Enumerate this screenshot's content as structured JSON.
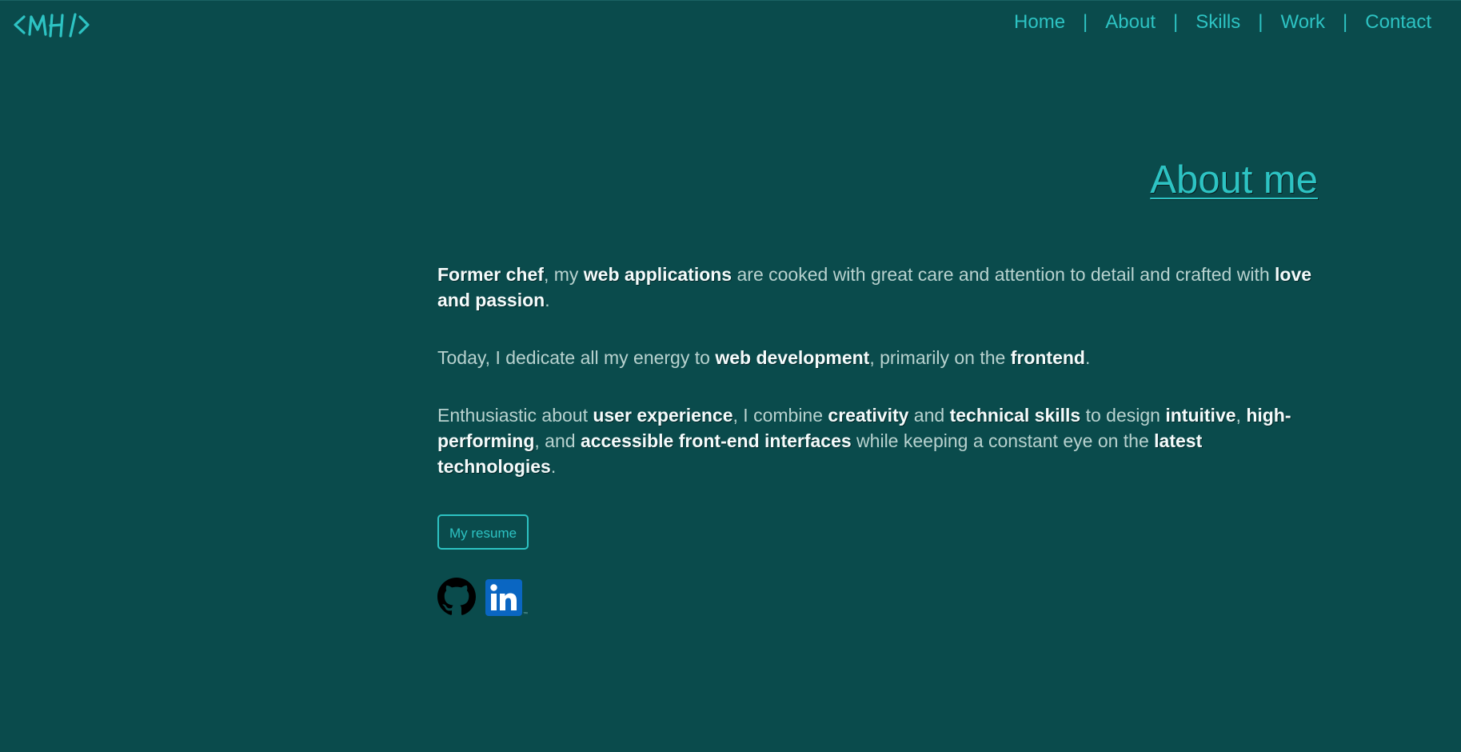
{
  "brand": {
    "logo_alt": "<MH/>",
    "logo_icon": "code-brackets-mh-logo"
  },
  "nav": {
    "items": [
      {
        "label": "Home"
      },
      {
        "label": "About"
      },
      {
        "label": "Skills"
      },
      {
        "label": "Work"
      },
      {
        "label": "Contact"
      }
    ],
    "separator": "|"
  },
  "about": {
    "title": "About me",
    "paragraphs": {
      "p1": {
        "b1": "Former chef",
        "t1": ", my ",
        "b2": "web applications",
        "t2": " are cooked with great care and attention to detail and crafted with ",
        "b3": "love and passion",
        "t3": "."
      },
      "p2": {
        "t1": "Today, I dedicate all my energy to ",
        "b1": "web development",
        "t2": ", primarily on the ",
        "b2": "frontend",
        "t3": "."
      },
      "p3": {
        "t1": "Enthusiastic about ",
        "b1": "user experience",
        "t2": ", I combine ",
        "b2": "creativity",
        "t3": " and ",
        "b3": "technical skills",
        "t4": " to design ",
        "b4": "intuitive",
        "t5": ", ",
        "b5": "high-performing",
        "t6": ", and ",
        "b6": "accessible front-end interfaces",
        "t7": " while keeping a constant eye on the ",
        "b7": "latest technologies",
        "t8": "."
      }
    },
    "resume_button": "My resume"
  },
  "socials": {
    "github_icon": "github-icon",
    "linkedin_icon": "linkedin-icon",
    "linkedin_tm": "™"
  },
  "colors": {
    "background": "#0a4b4c",
    "accent": "#2dc3c3",
    "text": "#b8d2cf",
    "highlight": "#f4fbfb",
    "linkedin_blue": "#0a66c2"
  }
}
